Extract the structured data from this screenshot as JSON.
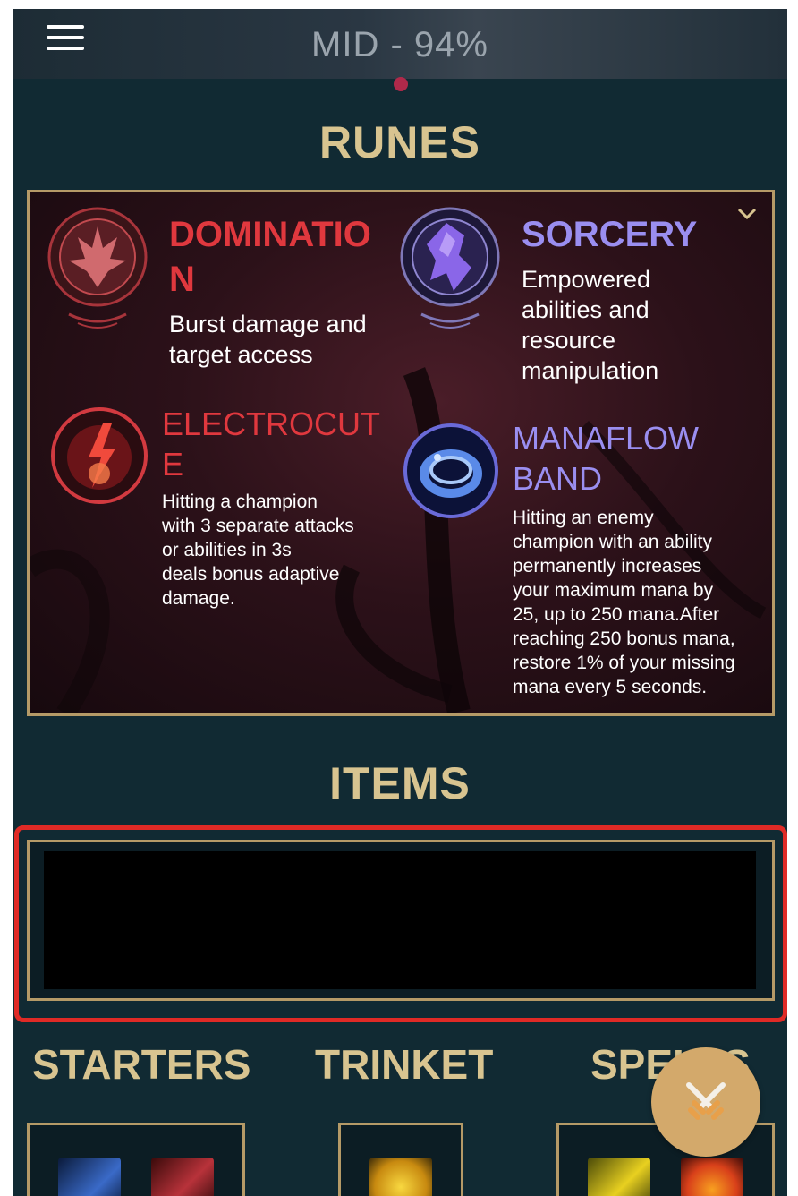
{
  "header": {
    "title": "MID - 94%"
  },
  "runes": {
    "section_title": "RUNES",
    "primary": {
      "name_line1": "DOMINATIO",
      "name_line2": "N",
      "desc_line1": "Burst damage and",
      "desc_line2": "target access",
      "color": "#e0383e"
    },
    "secondary": {
      "name": "SORCERY",
      "desc_line1": "Empowered",
      "desc_line2": "abilities and",
      "desc_line3": "resource",
      "desc_line4": "manipulation",
      "color": "#9a8ef0"
    },
    "keystone": {
      "name_line1": "ELECTROCUT",
      "name_line2": "E",
      "desc_line1": "Hitting a champion",
      "desc_line2": "with 3 separate attacks",
      "desc_line3": "or abilities in 3s",
      "desc_line4": "deals bonus adaptive",
      "desc_line5": "damage.",
      "color": "#e0383e"
    },
    "secondary_rune": {
      "name_line1": "MANAFLOW",
      "name_line2": "BAND",
      "desc_line1": "Hitting an enemy",
      "desc_line2": "champion with an ability",
      "desc_line3": "permanently increases",
      "desc_line4": "your maximum mana by",
      "desc_line5": "25, up to 250 mana.After",
      "desc_line6": "reaching 250 bonus mana,",
      "desc_line7": "restore 1% of your missing",
      "desc_line8": "mana every 5 seconds.",
      "color": "#9a8ef0"
    }
  },
  "items": {
    "section_title": "ITEMS"
  },
  "categories": {
    "starters": "STARTERS",
    "trinket": "TRINKET",
    "spells": "SPELLS"
  },
  "colors": {
    "background": "#112a33",
    "gold": "#d8c490",
    "frame": "#b59a67",
    "highlight": "#e02a26",
    "fab": "#d3a96b"
  },
  "icons": {
    "menu": "hamburger-menu-icon",
    "expand": "chevron-down-icon",
    "fab": "crossed-swords-icon"
  }
}
